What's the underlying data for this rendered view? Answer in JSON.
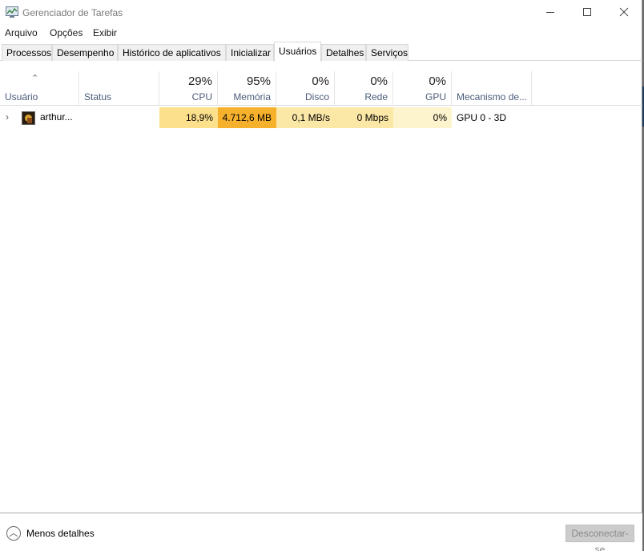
{
  "window": {
    "title": "Gerenciador de Tarefas"
  },
  "menu": [
    {
      "label": "Arquivo"
    },
    {
      "label": "Opções"
    },
    {
      "label": "Exibir"
    }
  ],
  "tabs": [
    {
      "label": "Processos"
    },
    {
      "label": "Desempenho"
    },
    {
      "label": "Histórico de aplicativos"
    },
    {
      "label": "Inicializar"
    },
    {
      "label": "Usuários",
      "active": true
    },
    {
      "label": "Detalhes"
    },
    {
      "label": "Serviços"
    }
  ],
  "columns": {
    "user": {
      "label": "Usuário"
    },
    "status": {
      "label": "Status"
    },
    "cpu": {
      "pct": "29%",
      "label": "CPU"
    },
    "memory": {
      "pct": "95%",
      "label": "Memória"
    },
    "disk": {
      "pct": "0%",
      "label": "Disco"
    },
    "network": {
      "pct": "0%",
      "label": "Rede"
    },
    "gpu": {
      "pct": "0%",
      "label": "GPU"
    },
    "gpu_engine": {
      "label": "Mecanismo de..."
    }
  },
  "rows": [
    {
      "user": "arthur...",
      "status": "",
      "cpu": "18,9%",
      "memory": "4.712,6 MB",
      "disk": "0,1 MB/s",
      "network": "0 Mbps",
      "gpu": "0%",
      "gpu_engine": "GPU 0 - 3D"
    }
  ],
  "footer": {
    "fewer_details": "Menos detalhes",
    "disconnect": "Desconectar-se"
  },
  "colors": {
    "cpu_heat": "#fde08c",
    "memory_heat": "#f6b12c",
    "disk_heat": "#fbe7a6",
    "network_heat": "#fbe7a6",
    "gpu_heat": "#fdf3cc"
  }
}
